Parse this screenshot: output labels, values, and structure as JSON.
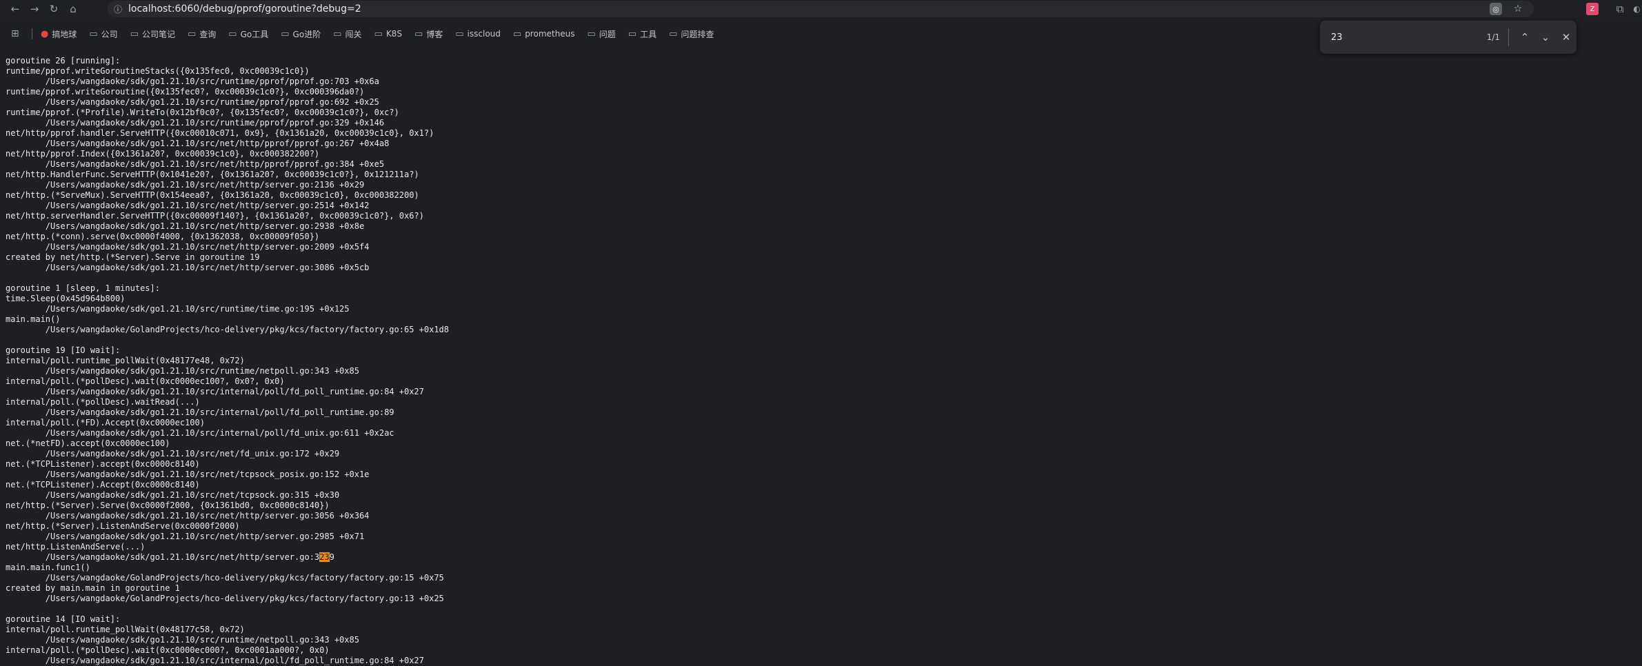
{
  "browser": {
    "url": "localhost:6060/debug/pprof/goroutine?debug=2",
    "bookmarks": [
      "搞地球",
      "公司",
      "公司笔记",
      "查询",
      "Go工具",
      "Go进阶",
      "闯关",
      "K8S",
      "博客",
      "isscloud",
      "prometheus",
      "问题",
      "工具",
      "问题排查"
    ],
    "extension_label": "Z"
  },
  "find": {
    "query": "23",
    "count": "1/1"
  },
  "highlight": {
    "line": 48,
    "before": "        /Users/wangdaoke/sdk/go1.21.10/src/net/http/server.go:3",
    "match": "23",
    "after": "9"
  },
  "lines": [
    "goroutine 26 [running]:",
    "runtime/pprof.writeGoroutineStacks({0x135fec0, 0xc00039c1c0})",
    "        /Users/wangdaoke/sdk/go1.21.10/src/runtime/pprof/pprof.go:703 +0x6a",
    "runtime/pprof.writeGoroutine({0x135fec0?, 0xc00039c1c0?}, 0xc000396da0?)",
    "        /Users/wangdaoke/sdk/go1.21.10/src/runtime/pprof/pprof.go:692 +0x25",
    "runtime/pprof.(*Profile).WriteTo(0x12bf0c0?, {0x135fec0?, 0xc00039c1c0?}, 0xc?)",
    "        /Users/wangdaoke/sdk/go1.21.10/src/runtime/pprof/pprof.go:329 +0x146",
    "net/http/pprof.handler.ServeHTTP({0xc00010c071, 0x9}, {0x1361a20, 0xc00039c1c0}, 0x1?)",
    "        /Users/wangdaoke/sdk/go1.21.10/src/net/http/pprof/pprof.go:267 +0x4a8",
    "net/http/pprof.Index({0x1361a20?, 0xc00039c1c0}, 0xc000382200?)",
    "        /Users/wangdaoke/sdk/go1.21.10/src/net/http/pprof/pprof.go:384 +0xe5",
    "net/http.HandlerFunc.ServeHTTP(0x1041e20?, {0x1361a20?, 0xc00039c1c0?}, 0x121211a?)",
    "        /Users/wangdaoke/sdk/go1.21.10/src/net/http/server.go:2136 +0x29",
    "net/http.(*ServeMux).ServeHTTP(0x154eea0?, {0x1361a20, 0xc00039c1c0}, 0xc000382200)",
    "        /Users/wangdaoke/sdk/go1.21.10/src/net/http/server.go:2514 +0x142",
    "net/http.serverHandler.ServeHTTP({0xc00009f140?}, {0x1361a20?, 0xc00039c1c0?}, 0x6?)",
    "        /Users/wangdaoke/sdk/go1.21.10/src/net/http/server.go:2938 +0x8e",
    "net/http.(*conn).serve(0xc0000f4000, {0x1362038, 0xc00009f050})",
    "        /Users/wangdaoke/sdk/go1.21.10/src/net/http/server.go:2009 +0x5f4",
    "created by net/http.(*Server).Serve in goroutine 19",
    "        /Users/wangdaoke/sdk/go1.21.10/src/net/http/server.go:3086 +0x5cb",
    "",
    "goroutine 1 [sleep, 1 minutes]:",
    "time.Sleep(0x45d964b800)",
    "        /Users/wangdaoke/sdk/go1.21.10/src/runtime/time.go:195 +0x125",
    "main.main()",
    "        /Users/wangdaoke/GolandProjects/hco-delivery/pkg/kcs/factory/factory.go:65 +0x1d8",
    "",
    "goroutine 19 [IO wait]:",
    "internal/poll.runtime_pollWait(0x48177e48, 0x72)",
    "        /Users/wangdaoke/sdk/go1.21.10/src/runtime/netpoll.go:343 +0x85",
    "internal/poll.(*pollDesc).wait(0xc0000ec100?, 0x0?, 0x0)",
    "        /Users/wangdaoke/sdk/go1.21.10/src/internal/poll/fd_poll_runtime.go:84 +0x27",
    "internal/poll.(*pollDesc).waitRead(...)",
    "        /Users/wangdaoke/sdk/go1.21.10/src/internal/poll/fd_poll_runtime.go:89",
    "internal/poll.(*FD).Accept(0xc0000ec100)",
    "        /Users/wangdaoke/sdk/go1.21.10/src/internal/poll/fd_unix.go:611 +0x2ac",
    "net.(*netFD).accept(0xc0000ec100)",
    "        /Users/wangdaoke/sdk/go1.21.10/src/net/fd_unix.go:172 +0x29",
    "net.(*TCPListener).accept(0xc0000c8140)",
    "        /Users/wangdaoke/sdk/go1.21.10/src/net/tcpsock_posix.go:152 +0x1e",
    "net.(*TCPListener).Accept(0xc0000c8140)",
    "        /Users/wangdaoke/sdk/go1.21.10/src/net/tcpsock.go:315 +0x30",
    "net/http.(*Server).Serve(0xc0000f2000, {0x1361bd0, 0xc0000c8140})",
    "        /Users/wangdaoke/sdk/go1.21.10/src/net/http/server.go:3056 +0x364",
    "net/http.(*Server).ListenAndServe(0xc0000f2000)",
    "        /Users/wangdaoke/sdk/go1.21.10/src/net/http/server.go:2985 +0x71",
    "net/http.ListenAndServe(...)",
    "        /Users/wangdaoke/sdk/go1.21.10/src/net/http/server.go:3239",
    "main.main.func1()",
    "        /Users/wangdaoke/GolandProjects/hco-delivery/pkg/kcs/factory/factory.go:15 +0x75",
    "created by main.main in goroutine 1",
    "        /Users/wangdaoke/GolandProjects/hco-delivery/pkg/kcs/factory/factory.go:13 +0x25",
    "",
    "goroutine 14 [IO wait]:",
    "internal/poll.runtime_pollWait(0x48177c58, 0x72)",
    "        /Users/wangdaoke/sdk/go1.21.10/src/runtime/netpoll.go:343 +0x85",
    "internal/poll.(*pollDesc).wait(0xc0000ec000?, 0xc0001aa000?, 0x0)",
    "        /Users/wangdaoke/sdk/go1.21.10/src/internal/poll/fd_poll_runtime.go:84 +0x27"
  ],
  "colors": {
    "background": "#1e1f22",
    "text": "#e8eaed",
    "highlight": "#f28b00"
  }
}
